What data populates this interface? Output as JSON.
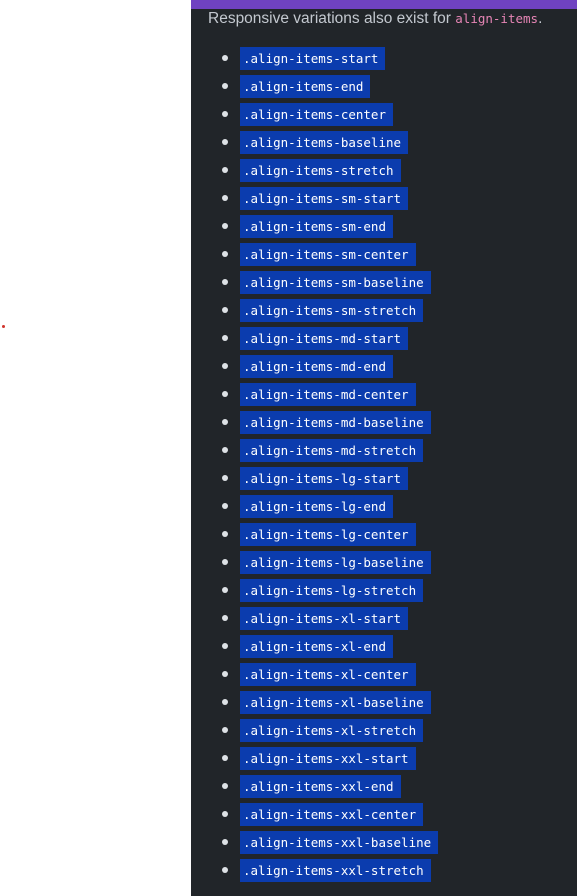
{
  "intro": {
    "text": "Responsive variations also exist for ",
    "code": "align-items",
    "suffix": "."
  },
  "classes": [
    ".align-items-start",
    ".align-items-end",
    ".align-items-center",
    ".align-items-baseline",
    ".align-items-stretch",
    ".align-items-sm-start",
    ".align-items-sm-end",
    ".align-items-sm-center",
    ".align-items-sm-baseline",
    ".align-items-sm-stretch",
    ".align-items-md-start",
    ".align-items-md-end",
    ".align-items-md-center",
    ".align-items-md-baseline",
    ".align-items-md-stretch",
    ".align-items-lg-start",
    ".align-items-lg-end",
    ".align-items-lg-center",
    ".align-items-lg-baseline",
    ".align-items-lg-stretch",
    ".align-items-xl-start",
    ".align-items-xl-end",
    ".align-items-xl-center",
    ".align-items-xl-baseline",
    ".align-items-xl-stretch",
    ".align-items-xxl-start",
    ".align-items-xxl-end",
    ".align-items-xxl-center",
    ".align-items-xxl-baseline",
    ".align-items-xxl-stretch"
  ],
  "colors": {
    "doc_background": "#212529",
    "accent_bar": "#6f42c1",
    "selection_highlight": "#0b3cae",
    "inline_code": "#e685b5"
  }
}
